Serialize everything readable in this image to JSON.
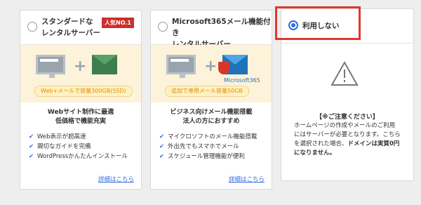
{
  "cards": [
    {
      "title": "スタンダードな\nレンタルサーバー",
      "badge": "人気NO.1",
      "pill": "Web+メールで容量300GB(SSD)",
      "lead": "Webサイト制作に最適\n低価格で機能充実",
      "features": [
        "Web表示が超高速",
        "親切なガイドを完備",
        "WordPressかんたんインストール"
      ],
      "more": "詳細はこちら"
    },
    {
      "title": "Microsoft365メール機能付き\nレンタルサーバー",
      "pill": "追加で専用メール容量50GB",
      "ms365": "Microsoft365",
      "lead": "ビジネス向けメール機能搭載\n法人の方におすすめ",
      "features": [
        "マイクロソフトのメール機能搭載",
        "外出先でもスマホでメール",
        "スケジュール管理機能が便利"
      ],
      "more": "詳細はこちら"
    }
  ],
  "none_option": {
    "label": "利用しない",
    "notice_title": "【※ご注意ください】",
    "notice_line1": "ホームページの作成やメールのご利用にはサーバーが必要となります。こちらを選択された場合、",
    "notice_emph": "ドメインは実質0円になりません。"
  },
  "colors": {
    "accent": "#2f6de1",
    "highlight_border": "#e0382e",
    "pill_bg": "#fff1c4",
    "badge_red": "#c9302c"
  }
}
